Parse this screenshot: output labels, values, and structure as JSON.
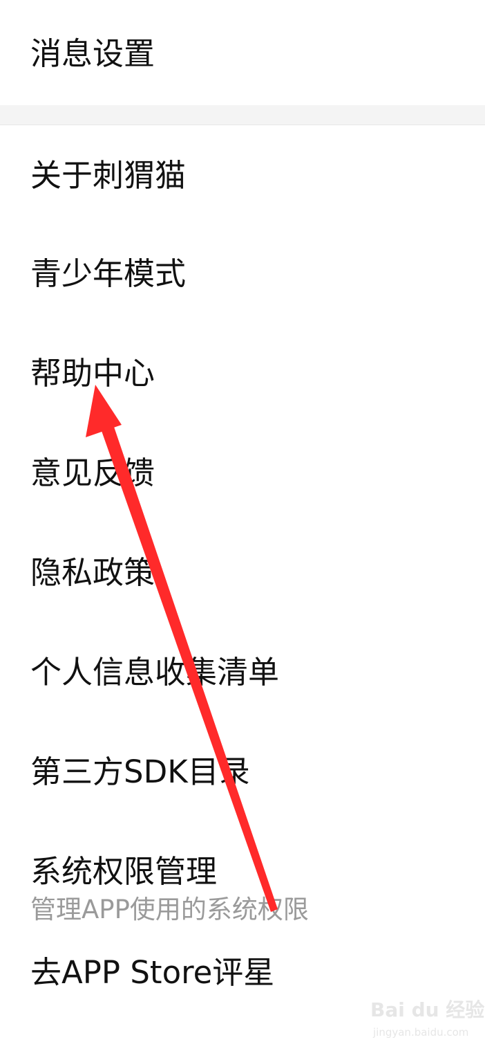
{
  "settings": {
    "items": [
      {
        "label": "消息设置"
      },
      {
        "label": "关于刺猬猫"
      },
      {
        "label": "青少年模式"
      },
      {
        "label": "帮助中心"
      },
      {
        "label": "意见反馈"
      },
      {
        "label": "隐私政策"
      },
      {
        "label": "个人信息收集清单"
      },
      {
        "label": "第三方SDK目录"
      },
      {
        "label": "系统权限管理",
        "subtitle": "管理APP使用的系统权限"
      },
      {
        "label": "去APP Store评星"
      }
    ]
  },
  "annotation": {
    "arrow_color": "#ff2a2a",
    "icon": "red-arrow-icon"
  },
  "watermark": {
    "main": "Bai du 经验",
    "sub": "jingyan.baidu.com"
  }
}
